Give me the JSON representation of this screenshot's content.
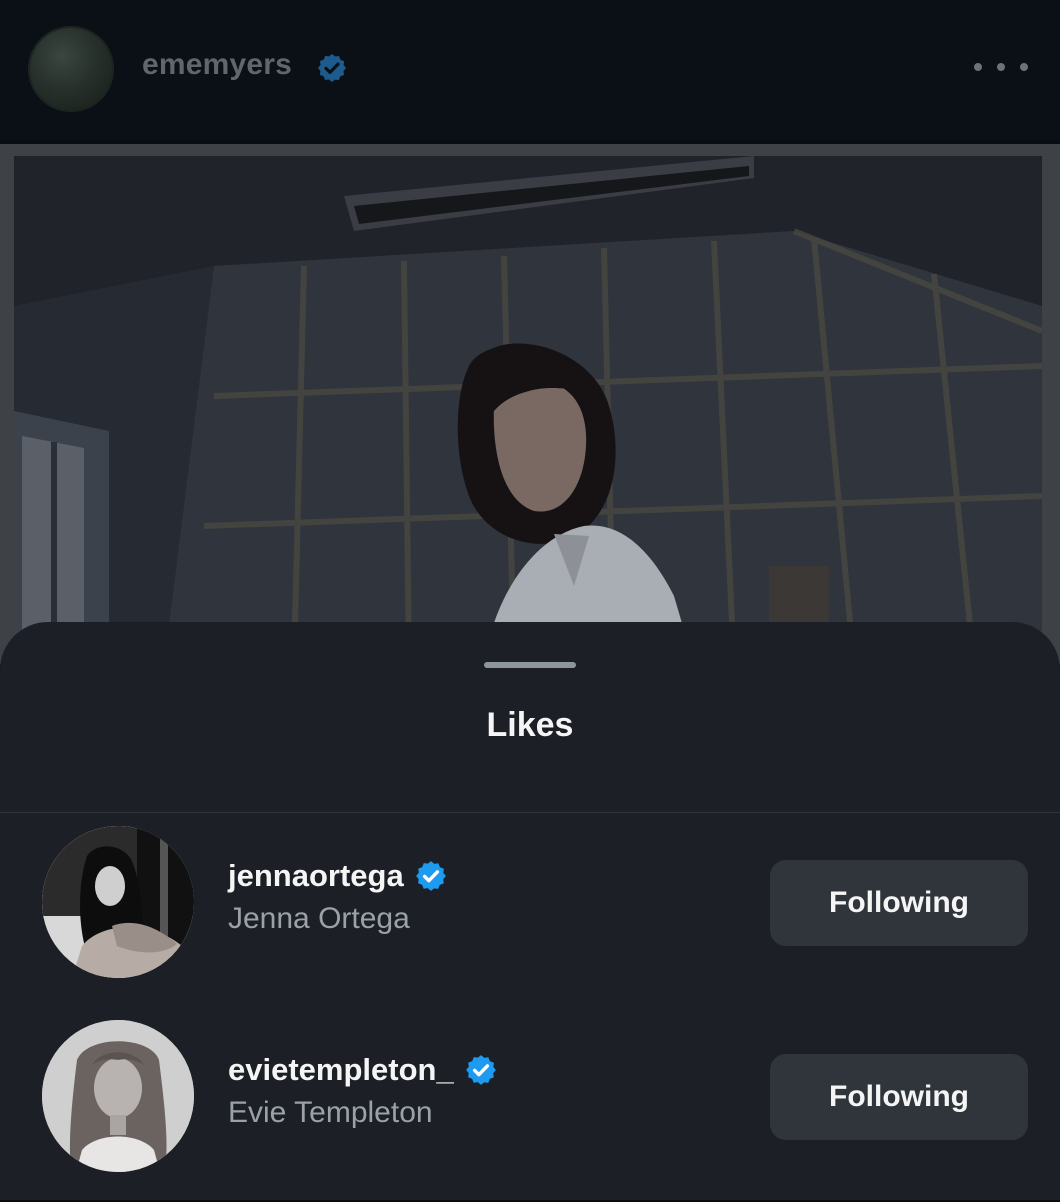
{
  "post": {
    "username": "ememyers",
    "verified_icon": "verified-badge-icon",
    "more_icon": "more-options-icon"
  },
  "likes_sheet": {
    "title": "Likes",
    "users": [
      {
        "username": "jennaortega",
        "full_name": "Jenna Ortega",
        "verified": true,
        "button": "Following"
      },
      {
        "username": "evietempleton_",
        "full_name": "Evie Templeton",
        "verified": true,
        "button": "Following"
      }
    ]
  },
  "colors": {
    "verified_blue": "#1d9bf0",
    "sheet_background": "#1c2026",
    "button_background": "#30353c"
  }
}
